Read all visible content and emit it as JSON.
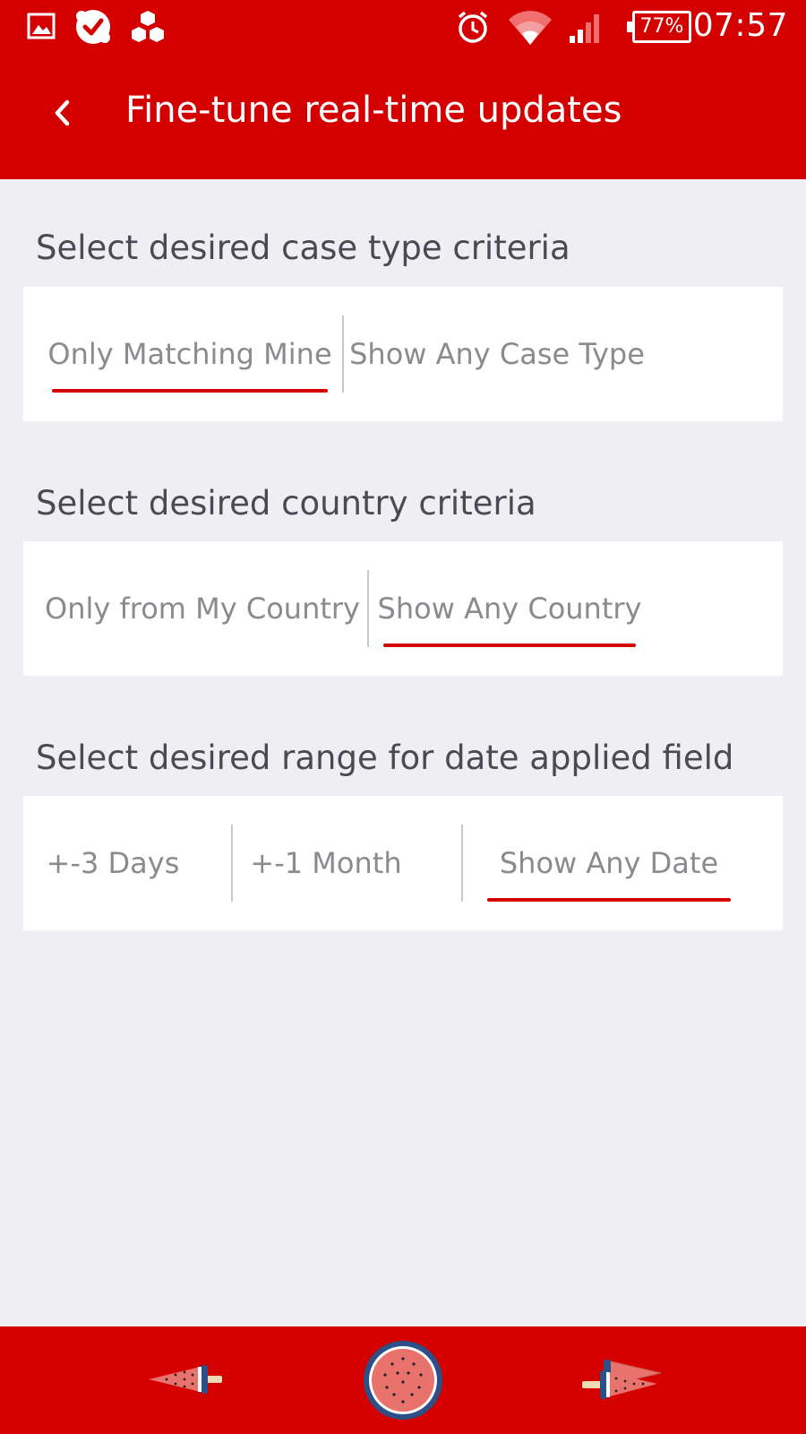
{
  "status_bar": {
    "time": "07:57",
    "battery": "77%",
    "icons": [
      "gallery-icon",
      "check-badge-icon",
      "hexagons-icon",
      "alarm-icon",
      "wifi-icon",
      "signal-icon"
    ]
  },
  "header": {
    "title": "Fine-tune real-time updates",
    "back_icon": "chevron-left-icon"
  },
  "sections": [
    {
      "title": "Select desired case type criteria",
      "options": [
        "Only Matching Mine",
        "Show Any Case Type"
      ],
      "selected": "Only Matching Mine"
    },
    {
      "title": "Select desired country criteria",
      "options": [
        "Only from My Country",
        "Show Any Country"
      ],
      "selected": "Show Any Country"
    },
    {
      "title": "Select desired range for date applied field",
      "options": [
        "+-3 Days",
        "+-1 Month",
        "Show Any Date"
      ],
      "selected": "Show Any Date"
    }
  ],
  "bottom_nav": {
    "items": [
      "watermelon-slice-left-icon",
      "watermelon-round-icon",
      "watermelon-slices-right-icon"
    ]
  },
  "colors": {
    "primary": "#d40000",
    "background": "#eeeef3",
    "card": "#ffffff",
    "title_text": "#4a4a52",
    "option_text": "#8a8a8f",
    "watermelon_flesh": "#e8736c",
    "watermelon_rind": "#2b4f86"
  }
}
